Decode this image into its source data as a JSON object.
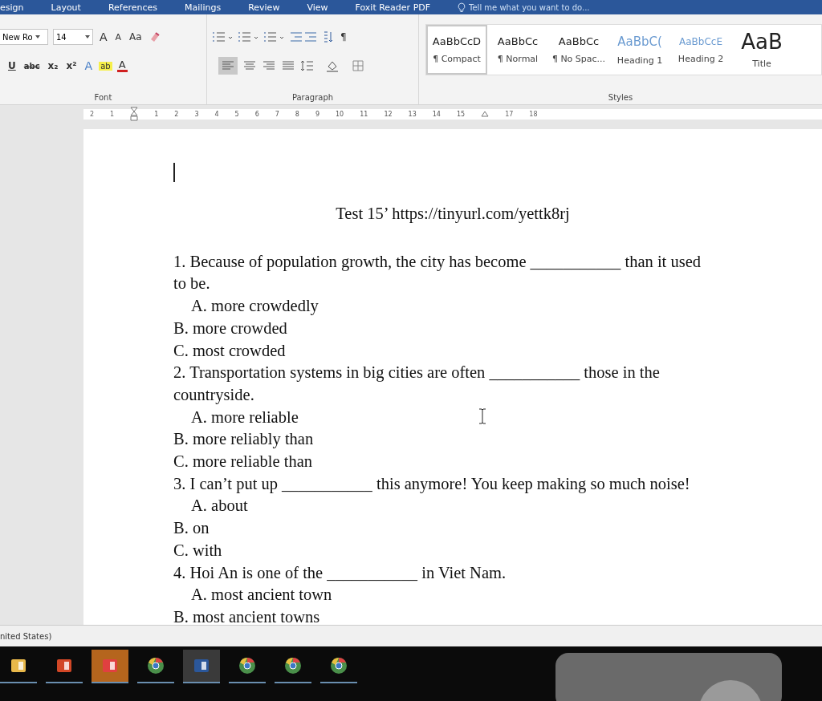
{
  "tabs": [
    {
      "label": "esign",
      "selected": false
    },
    {
      "label": "Layout",
      "selected": false
    },
    {
      "label": "References",
      "selected": false
    },
    {
      "label": "Mailings",
      "selected": false
    },
    {
      "label": "Review",
      "selected": false
    },
    {
      "label": "View",
      "selected": false
    },
    {
      "label": "Foxit Reader PDF",
      "selected": false
    }
  ],
  "tell_me": {
    "placeholder": "Tell me what you want to do..."
  },
  "font_group": {
    "label": "Font",
    "font_name": "New Ro",
    "font_size": "14",
    "grow": "A",
    "shrink": "A",
    "change_case": "Aa",
    "underline": "U",
    "strikethrough": "abc",
    "subscript": "x₂",
    "superscript": "x²",
    "text_effects": "A",
    "highlight": "ab",
    "font_color": "A"
  },
  "paragraph_group": {
    "label": "Paragraph",
    "show_marks": "¶",
    "align_left_selected": true
  },
  "styles_group": {
    "label": "Styles",
    "styles": [
      {
        "preview": "AaBbCcD",
        "name": "¶ Compact",
        "kind": "body",
        "selected": true
      },
      {
        "preview": "AaBbCc",
        "name": "¶ Normal",
        "kind": "body",
        "selected": false
      },
      {
        "preview": "AaBbCc",
        "name": "¶ No Spac...",
        "kind": "body",
        "selected": false
      },
      {
        "preview": "AaBbC(",
        "name": "Heading 1",
        "kind": "heading",
        "selected": false
      },
      {
        "preview": "AaBbCcE",
        "name": "Heading 2",
        "kind": "subheading",
        "selected": false
      },
      {
        "preview": "AaB",
        "name": "Title",
        "kind": "title",
        "selected": false
      }
    ]
  },
  "ruler": {
    "left_numbers": [
      "2",
      "1"
    ],
    "numbers": [
      "1",
      "2",
      "3",
      "4",
      "5",
      "6",
      "7",
      "8",
      "9",
      "10",
      "11",
      "12",
      "13",
      "14",
      "15"
    ],
    "right_numbers": [
      "17",
      "18"
    ]
  },
  "document": {
    "title": "Test 15’  https://tinyurl.com/yettk8rj",
    "paragraphs": [
      {
        "kind": "question",
        "before": "1. Because of population growth, the city has become",
        "blank": "___________",
        "after": "than it used to be."
      },
      {
        "kind": "option",
        "text": "A. more crowdedly",
        "indented": true
      },
      {
        "kind": "option",
        "text": "B. more crowded",
        "indented": false
      },
      {
        "kind": "option",
        "text": "C. most crowded",
        "indented": false
      },
      {
        "kind": "question",
        "before": "2. Transportation systems in big cities are often",
        "blank": "___________",
        "after": "those in the countryside."
      },
      {
        "kind": "option",
        "text": "A. more reliable",
        "indented": true
      },
      {
        "kind": "option",
        "text": "B. more reliably than",
        "indented": false
      },
      {
        "kind": "option",
        "text": "C. more reliable than",
        "indented": false
      },
      {
        "kind": "question",
        "before": "3. I can’t put up",
        "blank": "___________",
        "after": "this anymore! You keep making so much noise!"
      },
      {
        "kind": "option",
        "text": "A. about",
        "indented": true
      },
      {
        "kind": "option",
        "text": " B. on",
        "indented": false
      },
      {
        "kind": "option",
        "text": "C. with",
        "indented": false
      },
      {
        "kind": "question",
        "before": "4. Hoi An is one of the",
        "blank": "___________",
        "after": "in Viet Nam."
      },
      {
        "kind": "option",
        "text": "A. most ancient town",
        "indented": true
      },
      {
        "kind": "option",
        "text": "B. most ancient towns",
        "indented": false
      }
    ]
  },
  "status_bar": {
    "language": "nited States)"
  },
  "taskbar": {
    "apps": [
      {
        "kind": "folder",
        "selected": false
      },
      {
        "kind": "slides",
        "selected": false
      },
      {
        "kind": "chat",
        "selected": true
      },
      {
        "kind": "browser",
        "selected": false
      },
      {
        "kind": "word",
        "selected": true
      },
      {
        "kind": "browser",
        "selected": false
      },
      {
        "kind": "browser",
        "selected": false
      },
      {
        "kind": "browser",
        "selected": false
      }
    ]
  }
}
